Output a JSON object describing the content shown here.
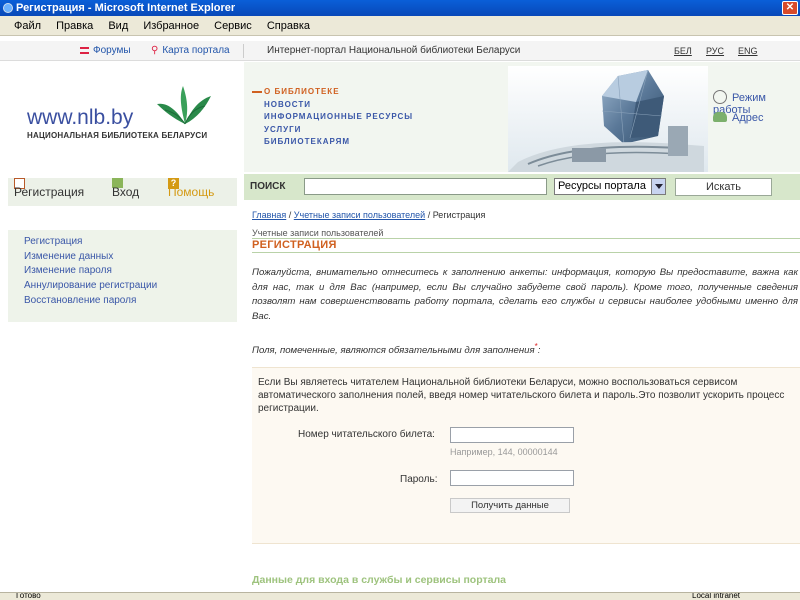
{
  "window": {
    "title": "Регистрация - Microsoft Internet Explorer"
  },
  "menubar": {
    "items": [
      "Файл",
      "Правка",
      "Вид",
      "Избранное",
      "Сервис",
      "Справка"
    ]
  },
  "topnav": {
    "forums": "Форумы",
    "map": "Карта портала",
    "portal_title": "Интернет-портал Национальной библиотеки Беларуси",
    "langs": [
      "БЕЛ",
      "РУС",
      "ENG"
    ]
  },
  "header": {
    "logo_url": "www.nlb.by",
    "logo_name": "НАЦИОНАЛЬНАЯ БИБЛИОТЕКА БЕЛАРУСИ",
    "menu": [
      "О БИБЛИОТЕКЕ",
      "НОВОСТИ",
      "ИНФОРМАЦИОННЫЕ РЕСУРСЫ",
      "УСЛУГИ",
      "БИБЛИОТЕКАРЯМ"
    ],
    "right_links": [
      "Режим работы",
      "Адрес"
    ]
  },
  "leftbar": {
    "register": "Регистрация",
    "login": "Вход",
    "help": "Помощь",
    "menu": [
      "Регистрация",
      "Изменение данных",
      "Изменение пароля",
      "Аннулирование регистрации",
      "Восстановление пароля"
    ]
  },
  "search": {
    "label": "ПОИСК",
    "value": "",
    "scope": "Ресурсы портала",
    "button": "Искать"
  },
  "content": {
    "crumb_home": "Главная",
    "crumb_sep": " / ",
    "crumb_accounts": "Учетные записи пользователей",
    "crumb_current": "Регистрация",
    "sub_title": "Учетные записи пользователей",
    "title": "РЕГИСТРАЦИЯ",
    "intro": "Пожалуйста, внимательно отнеситесь к заполнению анкеты: информация, которую Вы предоставите, важна как для нас, так и для Вас (например, если Вы случайно забудете свой пароль). Кроме того, полученные сведения позволят нам совершенствовать работу портала, сделать его службы и сервисы наиболее удобными именно для Вас.",
    "required_note": "Поля, помеченные, являются обязательными для заполнения",
    "required_mark": "*",
    "required_colon": ":",
    "notice": "Если Вы являетесь читателем Национальной библиотеки Беларуси, можно воспользоваться сервисом автоматического заполнения полей, введя номер читательского билета и пароль.Это позволит ускорить процесс регистрации.",
    "ticket_label": "Номер читательского билета:",
    "ticket_value": "",
    "ticket_hint": "Например, 144, 00000144",
    "password_label": "Пароль:",
    "password_value": "",
    "get_data_button": "Получить данные",
    "section2_title": "Данные для входа в службы и сервисы портала"
  },
  "statusbar": {
    "left": "Готово",
    "right": "Local intranet"
  },
  "colors": {
    "accent_orange": "#d06020",
    "link_blue": "#2255aa",
    "green_bar": "#d7e7cb"
  }
}
